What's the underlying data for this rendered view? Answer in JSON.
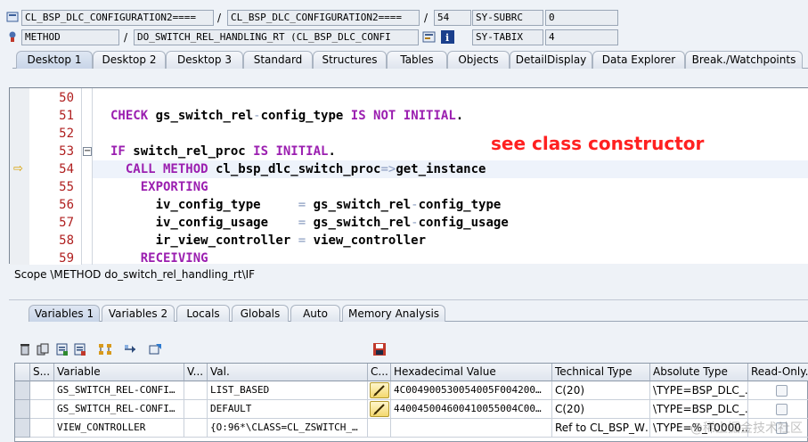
{
  "header": {
    "row1": {
      "field1": "CL_BSP_DLC_CONFIGURATION2====",
      "field2": "CL_BSP_DLC_CONFIGURATION2====",
      "line": "54",
      "sysvar_name": "SY-SUBRC",
      "sysvar_value": "0"
    },
    "row2": {
      "field1": "METHOD",
      "field2": "DO_SWITCH_REL_HANDLING_RT (CL_BSP_DLC_CONFI",
      "sysvar_name": "SY-TABIX",
      "sysvar_value": "4"
    }
  },
  "top_tabs": [
    "Desktop 1",
    "Desktop 2",
    "Desktop 3",
    "Standard",
    "Structures",
    "Tables",
    "Objects",
    "DetailDisplay",
    "Data Explorer",
    "Break./Watchpoints"
  ],
  "editor": {
    "lines": [
      {
        "num": "50",
        "code": ""
      },
      {
        "num": "51",
        "code": "CHECK gs_switch_rel-config_type IS NOT INITIAL."
      },
      {
        "num": "52",
        "code": ""
      },
      {
        "num": "53",
        "code": "IF switch_rel_proc IS INITIAL."
      },
      {
        "num": "54",
        "code": "CALL METHOD cl_bsp_dlc_switch_proc=>get_instance"
      },
      {
        "num": "55",
        "code": "EXPORTING"
      },
      {
        "num": "56",
        "code": "iv_config_type     = gs_switch_rel-config_type"
      },
      {
        "num": "57",
        "code": "iv_config_usage    = gs_switch_rel-config_usage"
      },
      {
        "num": "58",
        "code": "ir_view_controller = view_controller"
      },
      {
        "num": "59",
        "code": "RECEIVING"
      }
    ],
    "annotation": "see class constructor",
    "fold_symbol": "−",
    "current_line_marker": "⇨"
  },
  "scope": "Scope \\METHOD do_switch_rel_handling_rt\\IF",
  "lower_tabs": [
    "Variables 1",
    "Variables 2",
    "Locals",
    "Globals",
    "Auto",
    "Memory Analysis"
  ],
  "grid": {
    "headers": [
      "S...",
      "Variable",
      "V...",
      "Val.",
      "C...",
      "Hexadecimal Value",
      "Technical Type",
      "Absolute Type",
      "Read-Only..."
    ],
    "rows": [
      {
        "variable": "GS_SWITCH_REL-CONFI…",
        "value": "LIST_BASED",
        "hex": "4C004900530054005F004200…",
        "tech": "C(20)",
        "abs": "\\TYPE=BSP_DLC_…"
      },
      {
        "variable": "GS_SWITCH_REL-CONFI…",
        "value": "DEFAULT",
        "hex": "440045004600410055004C00…",
        "tech": "C(20)",
        "abs": "\\TYPE=BSP_DLC_…"
      },
      {
        "variable": "VIEW_CONTROLLER",
        "value": "{O:96*\\CLASS=CL_ZSWITCH_…",
        "hex": "",
        "tech": "Ref to CL_BSP_W…",
        "abs": "\\TYPE=%_T0000…"
      }
    ]
  },
  "watermark": "@稀土掘金技术社区"
}
